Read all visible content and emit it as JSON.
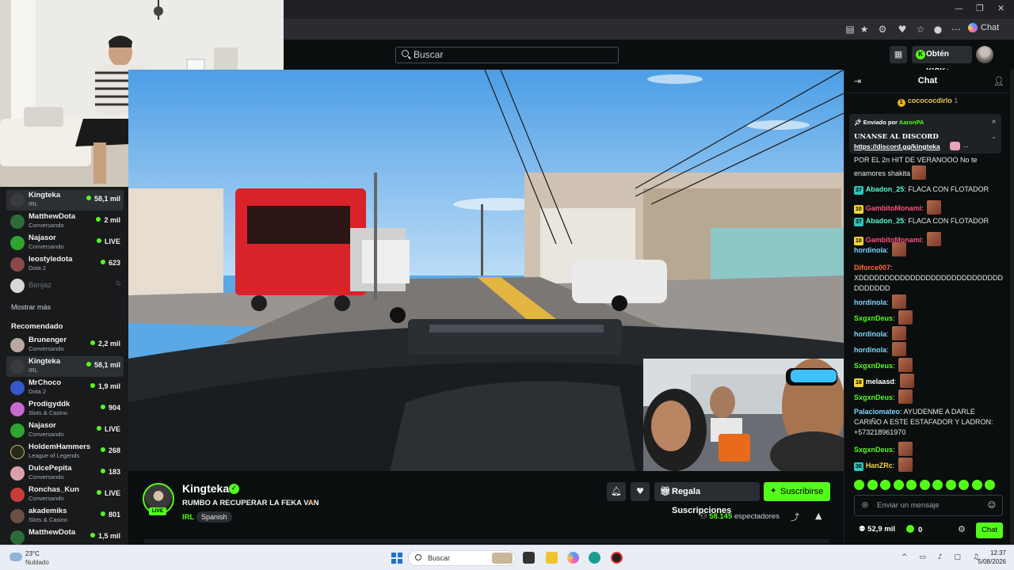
{
  "browser": {
    "chat_button_label": "Chat",
    "window_controls": [
      "—",
      "❐",
      "✕"
    ]
  },
  "header": {
    "search_placeholder": "Buscar",
    "get_kicks_label": "Obtén KICKs"
  },
  "sidebar": {
    "following": [
      {
        "name": "Kingteka",
        "category": "IRL",
        "viewers": "58,1 mil",
        "active": true,
        "avatar_color": "#3b3b3b"
      },
      {
        "name": "MatthewDota",
        "category": "Conversando",
        "viewers": "2 mil",
        "avatar_color": "#2f6b3a"
      },
      {
        "name": "Najasor",
        "category": "Conversando",
        "viewers": "LIVE",
        "avatar_color": "#2ea52e"
      },
      {
        "name": "leostyledota",
        "category": "Dota 2",
        "viewers": "623",
        "avatar_color": "#8a4a4a"
      }
    ],
    "offline": {
      "name": "Benjaz"
    },
    "show_more": "Mostrar más",
    "recommended_title": "Recomendado",
    "recommended": [
      {
        "name": "Brunenger",
        "category": "Conversando",
        "viewers": "2,2 mil",
        "avatar_color": "#b8a8a0"
      },
      {
        "name": "Kingteka",
        "category": "IRL",
        "viewers": "58,1 mil",
        "active": true,
        "avatar_color": "#3b3b3b"
      },
      {
        "name": "MrChoco",
        "category": "Dota 2",
        "viewers": "1,9 mil",
        "avatar_color": "#3656c9"
      },
      {
        "name": "Prodigyddk",
        "category": "Slots & Casino",
        "viewers": "904",
        "avatar_color": "#c96ad0"
      },
      {
        "name": "Najasor",
        "category": "Conversando",
        "viewers": "LIVE",
        "avatar_color": "#2ea52e"
      },
      {
        "name": "HoldemHammers",
        "category": "League of Legends",
        "viewers": "268",
        "avatar_color": "#2a2a1a"
      },
      {
        "name": "DulcePepita",
        "category": "Conversando",
        "viewers": "183",
        "avatar_color": "#d9a0a8"
      },
      {
        "name": "Ronchas_Kun",
        "category": "Conversando",
        "viewers": "LIVE",
        "avatar_color": "#c83c3c"
      },
      {
        "name": "akademiks",
        "category": "Slots & Casino",
        "viewers": "801",
        "avatar_color": "#6a5040"
      },
      {
        "name": "MatthewDota",
        "category": "",
        "viewers": "1,5 mil",
        "avatar_color": "#2f6b3a"
      }
    ]
  },
  "stream": {
    "streamer": "Kingteka",
    "live_label": "LIVE",
    "title": "RUMBO A RECUPERAR LA FEKA VAN",
    "category": "IRL",
    "language": "Spanish",
    "gift_subs_label": "Regala Suscripciones",
    "subscribe_label": "Suscribirse",
    "viewers_count": "58.145",
    "viewers_label": "espectadores"
  },
  "chat": {
    "title": "Chat",
    "top_gifter": {
      "name": "cocococdirlo",
      "count": "1"
    },
    "pinned": {
      "sent_by_label": "Enviado por",
      "sent_by_user": "AaronPA",
      "line1": "UNANSE AL DISCORD",
      "line2": "https://discord.gg/kingteka",
      "more": "..."
    },
    "messages": [
      {
        "user": "",
        "badge": "",
        "text": "POR EL 2n HIT DE VERANOOO No te enamores shakita",
        "color": "#e8e8e8",
        "emote": true
      },
      {
        "user": "Abadon_25",
        "badge": "37",
        "badge_color": "#2ec4b6",
        "text": "FLACA CON FLOTADOR",
        "color": "#53fcd0"
      },
      {
        "user": "GambitoMonami",
        "badge": "10",
        "badge_color": "#f2d43a",
        "text": "",
        "color": "#ff4f7a",
        "emote": true
      },
      {
        "user": "Abadon_25",
        "badge": "37",
        "badge_color": "#2ec4b6",
        "text": "FLACA CON FLOTADOR",
        "color": "#53fcd0"
      },
      {
        "user": "GambitoMonami",
        "badge": "10",
        "badge_color": "#f2d43a",
        "text": "",
        "color": "#ff4f7a",
        "emote": true
      },
      {
        "user": "hordinola",
        "badge": "",
        "text": "",
        "color": "#7fd4ff",
        "emote": true
      },
      {
        "user": "Diforce007",
        "badge": "",
        "text": "XDDDDDDDDDDDDDDDDDDDDDDDDDDDDDDDDDDD",
        "color": "#ff6a3d"
      },
      {
        "user": "hordinola",
        "badge": "",
        "text": "",
        "color": "#7fd4ff",
        "emote": true
      },
      {
        "user": "SxgxnDeus",
        "badge": "",
        "text": "",
        "color": "#53fc18",
        "emote": true
      },
      {
        "user": "hordinola",
        "badge": "",
        "text": "",
        "color": "#7fd4ff",
        "emote": true
      },
      {
        "user": "hordinola",
        "badge": "",
        "text": "",
        "color": "#7fd4ff",
        "emote": true
      },
      {
        "user": "SxgxnDeus",
        "badge": "",
        "text": "",
        "color": "#53fc18",
        "emote": true
      },
      {
        "user": "melaasd",
        "badge": "18",
        "badge_color": "#f2d43a",
        "text": "",
        "color": "#ffffff",
        "emote": true
      },
      {
        "user": "SxgxnDeus",
        "badge": "",
        "text": "",
        "color": "#53fc18",
        "emote": true
      },
      {
        "user": "Palaciomateo",
        "badge": "",
        "text": "AYUDENME A DARLE CARIÑO A ESTE ESTAFADOR Y LADRON: +573218961970",
        "color": "#7fd4ff"
      },
      {
        "user": "SxgxnDeus",
        "badge": "",
        "text": "",
        "color": "#53fc18",
        "emote": true
      },
      {
        "user": "HanZRc",
        "badge": "30",
        "badge_color": "#2ec4b6",
        "text": "",
        "color": "#f2d43a",
        "emote": true
      }
    ],
    "input_placeholder": "Enviar un mensaje",
    "kicks_count": "52,9 mil",
    "kicks_balance": "0",
    "send_label": "Chat"
  },
  "taskbar": {
    "weather_temp": "23°C",
    "weather_desc": "Nublado",
    "search_label": "Buscar",
    "time": "12:37",
    "date": "5/08/2026"
  },
  "colors": {
    "accent": "#53fc18",
    "background": "#0b0e0f",
    "sidebar": "#181a1c"
  }
}
